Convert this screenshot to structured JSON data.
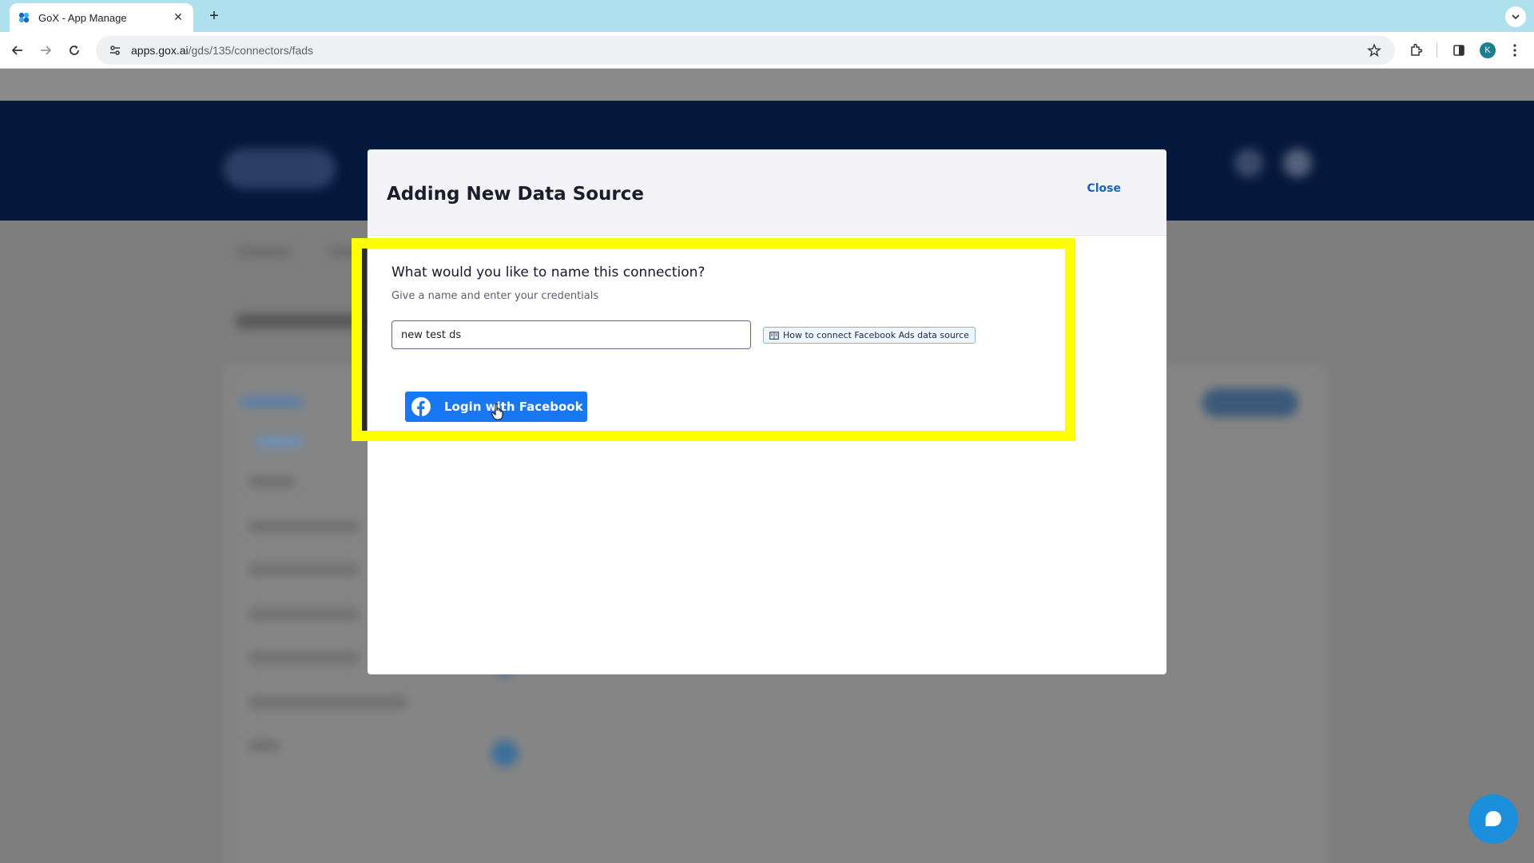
{
  "browser": {
    "tab_title": "GoX - App Manage",
    "url_host": "apps.gox.ai",
    "url_path": "/gds/135/connectors/fads",
    "profile_initial": "K"
  },
  "modal": {
    "title": "Adding New Data Source",
    "close_label": "Close",
    "question": "What would you like to name this connection?",
    "hint": "Give a name and enter your credentials",
    "name_value": "new test ds",
    "howto_label": "How to connect Facebook Ads data source",
    "fb_button_label": "Login with Facebook"
  },
  "colors": {
    "highlight": "#ffff00",
    "facebook_blue": "#1877f2",
    "link_blue": "#1565c0",
    "chat_bubble": "#1c8fdc"
  }
}
